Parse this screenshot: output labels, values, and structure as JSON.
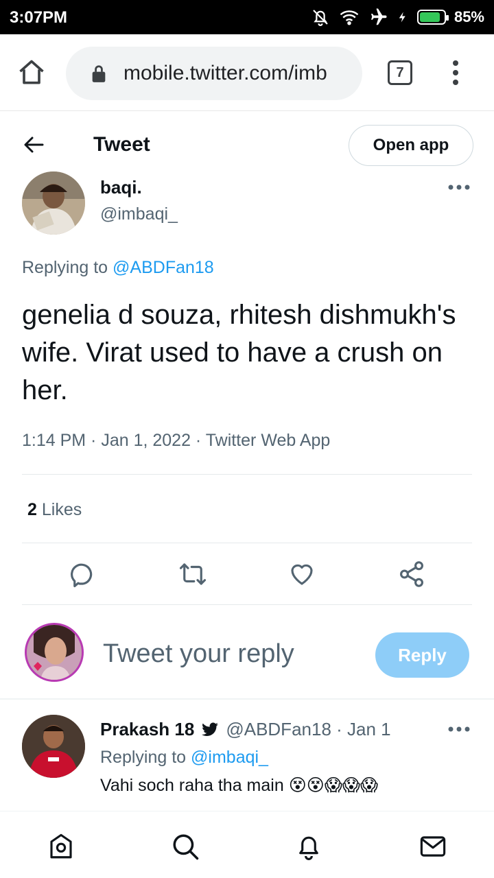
{
  "status_bar": {
    "time": "3:07PM",
    "battery_percent": "85%",
    "icons": [
      "bell-muted-icon",
      "wifi-icon",
      "airplane-icon",
      "charging-icon",
      "battery-icon"
    ]
  },
  "browser": {
    "url": "mobile.twitter.com/imb",
    "tab_count": "7",
    "icons": [
      "home-icon",
      "lock-icon",
      "tabs-icon",
      "more-vert-icon"
    ]
  },
  "header": {
    "title": "Tweet",
    "open_app_label": "Open app"
  },
  "tweet": {
    "author_name": "baqi.",
    "author_handle": "@imbaqi_",
    "replying_prefix": "Replying to",
    "replying_to": "@ABDFan18",
    "text": "genelia d souza, rhitesh dishmukh's wife. Virat used to have a crush on her.",
    "meta": "1:14 PM · Jan 1, 2022 · Twitter Web App",
    "likes_count": "2",
    "likes_label": "Likes"
  },
  "composer": {
    "placeholder": "Tweet your reply",
    "reply_label": "Reply"
  },
  "reply": {
    "author_name": "Prakash 18",
    "author_handle": "@ABDFan18 · Jan 1",
    "replying_prefix": "Replying to",
    "replying_to": "@imbaqi_",
    "text": "Vahi soch raha tha main 😵😵😱😱😱"
  },
  "bottom_nav": [
    "home-icon",
    "search-icon",
    "notifications-icon",
    "messages-icon"
  ],
  "colors": {
    "accent": "#1d9bf0",
    "reply_button_disabled": "#8ecdf8",
    "secondary_text": "#536471",
    "primary_text": "#0f1419"
  }
}
